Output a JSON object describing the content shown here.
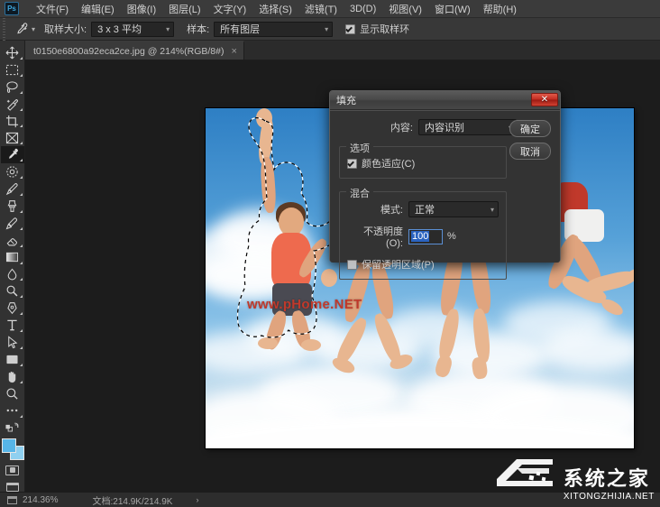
{
  "app": {
    "logo_text": "Ps",
    "menus": [
      {
        "label": "文件(F)",
        "name": "menu-file"
      },
      {
        "label": "编辑(E)",
        "name": "menu-edit"
      },
      {
        "label": "图像(I)",
        "name": "menu-image"
      },
      {
        "label": "图层(L)",
        "name": "menu-layer"
      },
      {
        "label": "文字(Y)",
        "name": "menu-type"
      },
      {
        "label": "选择(S)",
        "name": "menu-select"
      },
      {
        "label": "滤镜(T)",
        "name": "menu-filter"
      },
      {
        "label": "3D(D)",
        "name": "menu-3d"
      },
      {
        "label": "视图(V)",
        "name": "menu-view"
      },
      {
        "label": "窗口(W)",
        "name": "menu-window"
      },
      {
        "label": "帮助(H)",
        "name": "menu-help"
      }
    ]
  },
  "options_bar": {
    "tool_icon": "eyedropper-icon",
    "sample_size_label": "取样大小:",
    "sample_size_value": "3 x 3 平均",
    "sample_label": "样本:",
    "sample_value": "所有图层",
    "show_ring_label": "显示取样环",
    "show_ring_checked": true
  },
  "document_tab": {
    "title": "t0150e6800a92eca2ce.jpg @ 214%(RGB/8#)",
    "close_glyph": "×"
  },
  "toolbar": {
    "tools": [
      {
        "name": "move-tool",
        "label": "移动工具"
      },
      {
        "name": "rectangular-marquee-tool",
        "label": "矩形选框工具"
      },
      {
        "name": "lasso-tool",
        "label": "套索工具"
      },
      {
        "name": "quick-selection-tool",
        "label": "快速选择工具"
      },
      {
        "name": "crop-tool",
        "label": "裁剪工具"
      },
      {
        "name": "frame-tool",
        "label": "画框工具"
      },
      {
        "name": "eyedropper-tool",
        "label": "吸管工具",
        "active": true
      },
      {
        "name": "spot-healing-brush-tool",
        "label": "污点修复画笔工具"
      },
      {
        "name": "brush-tool",
        "label": "画笔工具"
      },
      {
        "name": "clone-stamp-tool",
        "label": "仿制图章工具"
      },
      {
        "name": "history-brush-tool",
        "label": "历史记录画笔工具"
      },
      {
        "name": "eraser-tool",
        "label": "橡皮擦工具"
      },
      {
        "name": "gradient-tool",
        "label": "渐变工具"
      },
      {
        "name": "blur-tool",
        "label": "模糊工具"
      },
      {
        "name": "dodge-tool",
        "label": "减淡工具"
      },
      {
        "name": "pen-tool",
        "label": "钢笔工具"
      },
      {
        "name": "type-tool",
        "label": "横排文字工具"
      },
      {
        "name": "path-selection-tool",
        "label": "路径选择工具"
      },
      {
        "name": "rectangle-tool",
        "label": "矩形工具"
      },
      {
        "name": "hand-tool",
        "label": "抓手工具"
      },
      {
        "name": "zoom-tool",
        "label": "缩放工具"
      },
      {
        "name": "edit-toolbar-tool",
        "label": "编辑工具栏"
      }
    ],
    "foreground_color": "#56b5e8",
    "background_color": "#8fd0f0"
  },
  "dialog": {
    "title": "填充",
    "close_glyph": "✕",
    "contents_label": "内容:",
    "contents_value": "内容识别",
    "ok_label": "确定",
    "cancel_label": "取消",
    "options_legend": "选项",
    "color_adaptation_label": "颜色适应(C)",
    "color_adaptation_checked": true,
    "blending_legend": "混合",
    "mode_label": "模式:",
    "mode_value": "正常",
    "opacity_label": "不透明度(O):",
    "opacity_value": "100",
    "opacity_unit": "%",
    "preserve_transparency_label": "保留透明区域(P)",
    "preserve_transparency_checked": false
  },
  "status_bar": {
    "zoom": "214.36%",
    "doc_size": "文档:214.9K/214.9K",
    "arrow_glyph": "›"
  },
  "watermarks": {
    "center": "www.pHome.NET",
    "corner_cn": "系统之家",
    "corner_en": "XITONGZHIJIA.NET"
  }
}
